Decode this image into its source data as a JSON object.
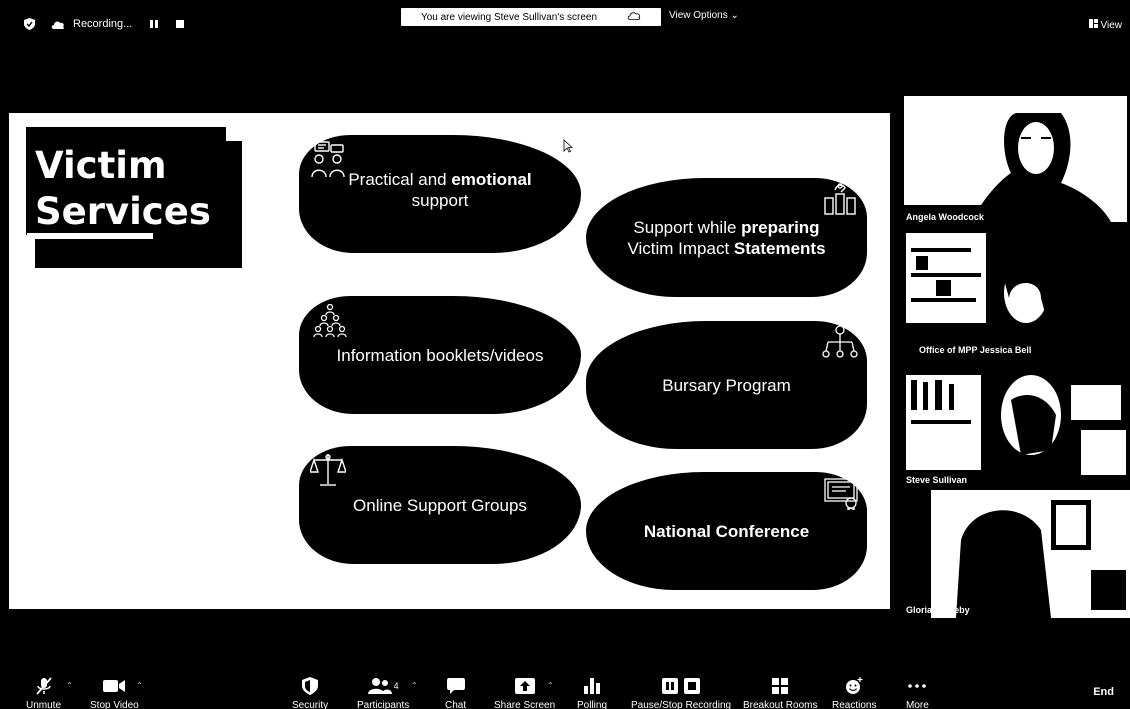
{
  "top": {
    "recording_label": "Recording...",
    "viewing_banner": "You are viewing Steve Sullivan's screen",
    "view_options": "View Options",
    "view_label": "View"
  },
  "slide": {
    "title_line1": "Victim",
    "title_line2": "Services",
    "cards": [
      {
        "text_plain": "Practical and ",
        "text_bold": "emotional",
        "text_line2": "support",
        "icon": "counseling-people-icon"
      },
      {
        "text_line1_plain": "Support while ",
        "text_line1_bold": "preparing",
        "text_line2_plain": "Victim Impact ",
        "text_line2_bold": "Statements",
        "icon": "documents-hand-icon"
      },
      {
        "text": "Information booklets/videos",
        "icon": "group-hierarchy-icon"
      },
      {
        "text": "Bursary Program",
        "icon": "network-nodes-icon"
      },
      {
        "text": "Online Support Groups",
        "icon": "scales-of-justice-icon"
      },
      {
        "text": "National Conference",
        "icon": "certificate-icon"
      }
    ]
  },
  "participants": [
    {
      "name": "Angela Woodcock"
    },
    {
      "name": "Office of MPP Jessica Bell"
    },
    {
      "name": "Steve Sullivan"
    },
    {
      "name": "Gloria Appleby"
    }
  ],
  "toolbar": {
    "unmute": "Unmute",
    "stop_video": "Stop Video",
    "security": "Security",
    "participants": "Participants",
    "participant_count": "4",
    "chat": "Chat",
    "share_screen": "Share Screen",
    "polling": "Polling",
    "pause_stop_recording": "Pause/Stop Recording",
    "breakout_rooms": "Breakout Rooms",
    "reactions": "Reactions",
    "more": "More",
    "end": "End"
  },
  "colors": {
    "background": "#000000",
    "slide_background": "#ffffff",
    "text": "#ffffff"
  }
}
